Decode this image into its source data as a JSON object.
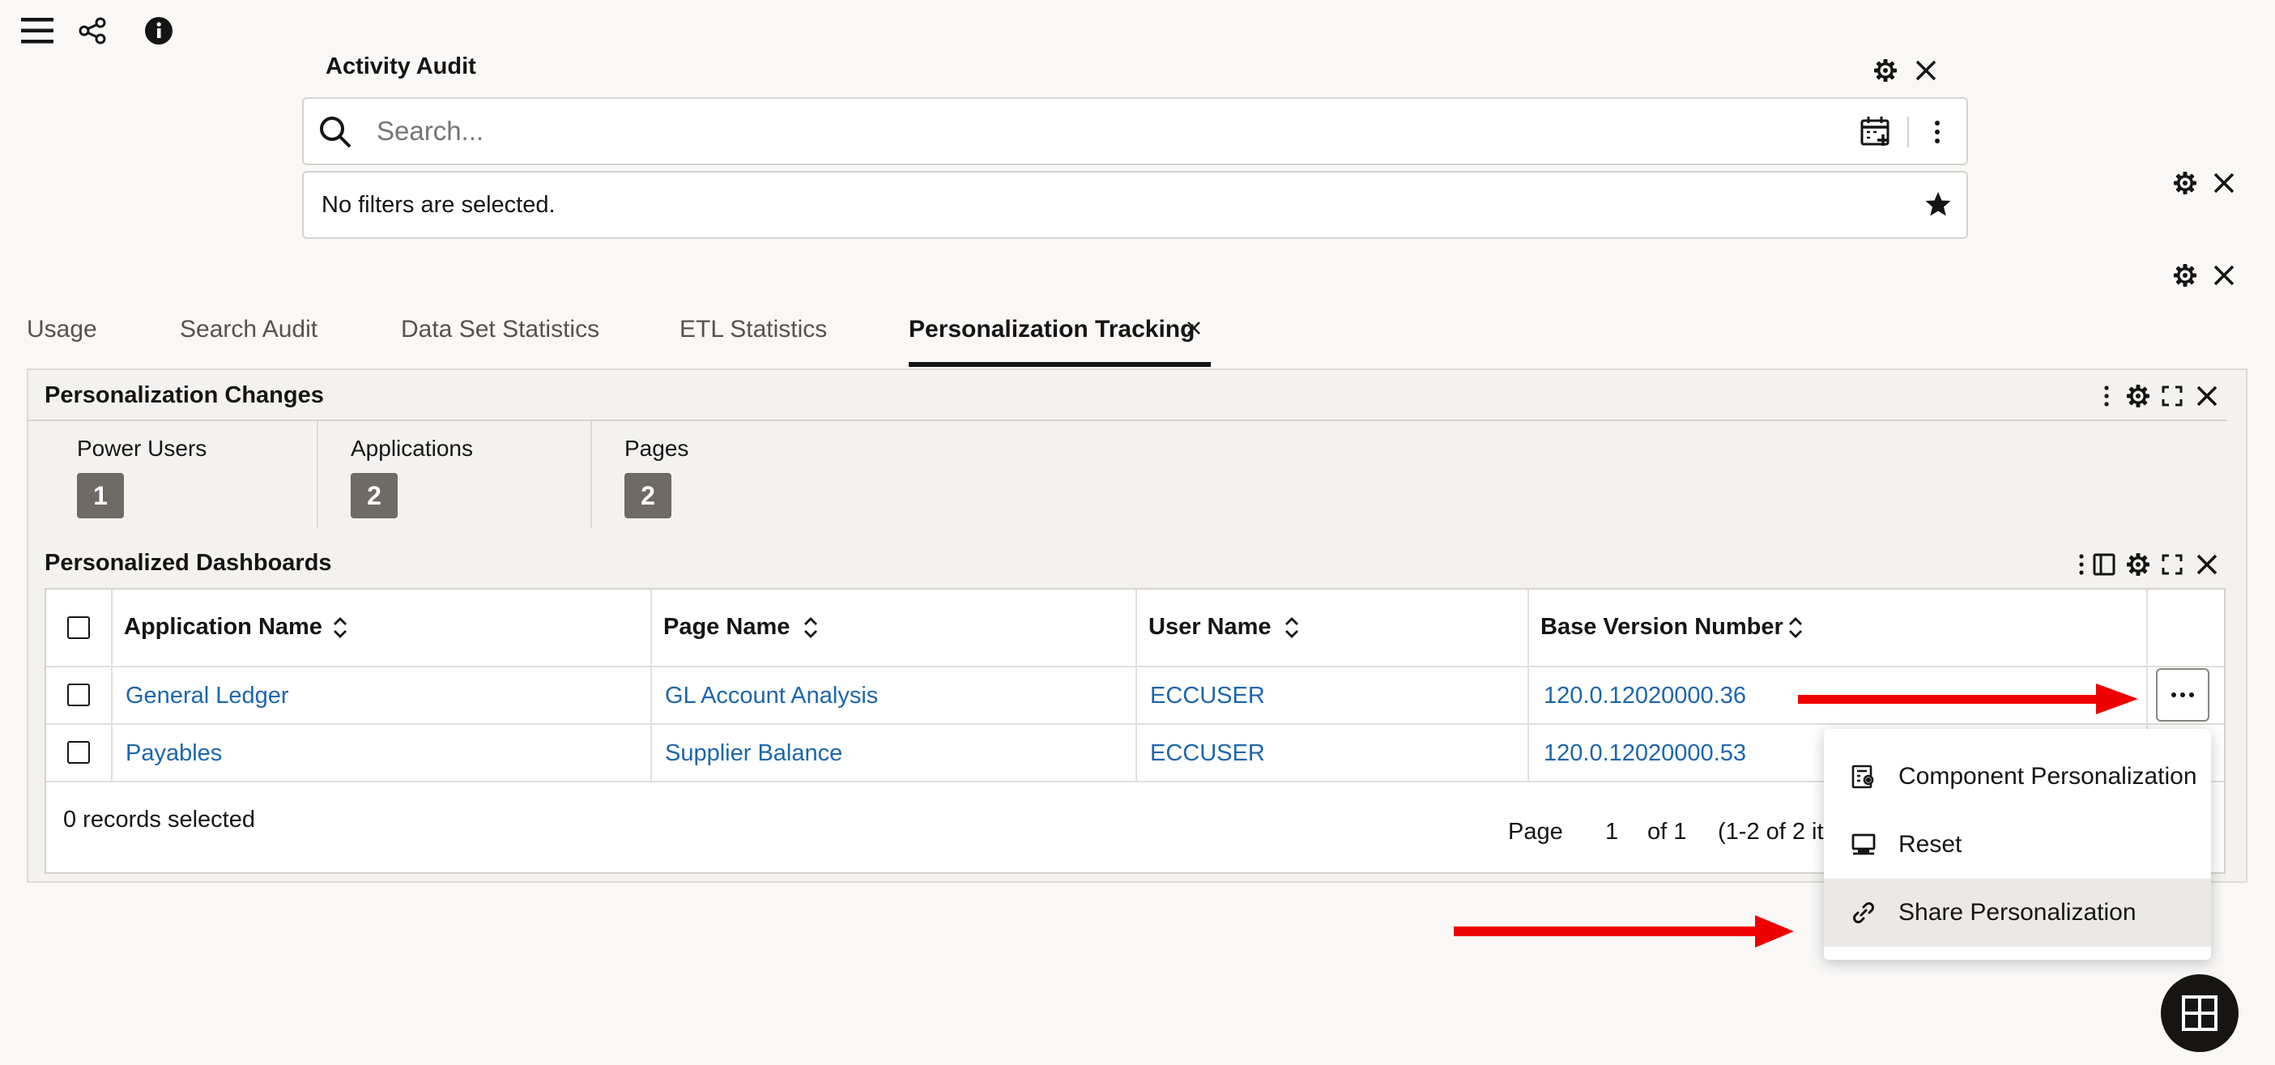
{
  "toolbar": {
    "icons": [
      "menu-icon",
      "share-icon",
      "info-icon"
    ]
  },
  "audit": {
    "title": "Activity Audit",
    "search_placeholder": "Search...",
    "filter_text": "No filters are selected."
  },
  "tabs": [
    {
      "label": "Usage"
    },
    {
      "label": "Search Audit"
    },
    {
      "label": "Data Set Statistics"
    },
    {
      "label": "ETL Statistics"
    },
    {
      "label": "Personalization Tracking",
      "active": true,
      "closable": true
    }
  ],
  "personalization_changes": {
    "title": "Personalization Changes",
    "metrics": [
      {
        "label": "Power Users",
        "value": "1"
      },
      {
        "label": "Applications",
        "value": "2"
      },
      {
        "label": "Pages",
        "value": "2"
      }
    ]
  },
  "dashboards": {
    "title": "Personalized Dashboards",
    "columns": [
      "Application Name",
      "Page Name",
      "User Name",
      "Base Version Number"
    ],
    "rows": [
      [
        "General Ledger",
        "GL Account Analysis",
        "ECCUSER",
        "120.0.12020000.36"
      ],
      [
        "Payables",
        "Supplier Balance",
        "ECCUSER",
        "120.0.12020000.53"
      ]
    ],
    "records_selected": "0 records selected",
    "pager": {
      "page_label": "Page",
      "page": "1",
      "of_label": "of 1",
      "range": "(1-2 of 2 it"
    }
  },
  "menu": {
    "items": [
      {
        "label": "Component Personalization",
        "icon": "component-personalization-icon"
      },
      {
        "label": "Reset",
        "icon": "reset-icon"
      },
      {
        "label": "Share Personalization",
        "icon": "link-icon",
        "highlighted": true
      }
    ]
  },
  "colors": {
    "link": "#1d66ad",
    "annotation_arrow": "#ee0000",
    "badge": "#6f6a64"
  }
}
